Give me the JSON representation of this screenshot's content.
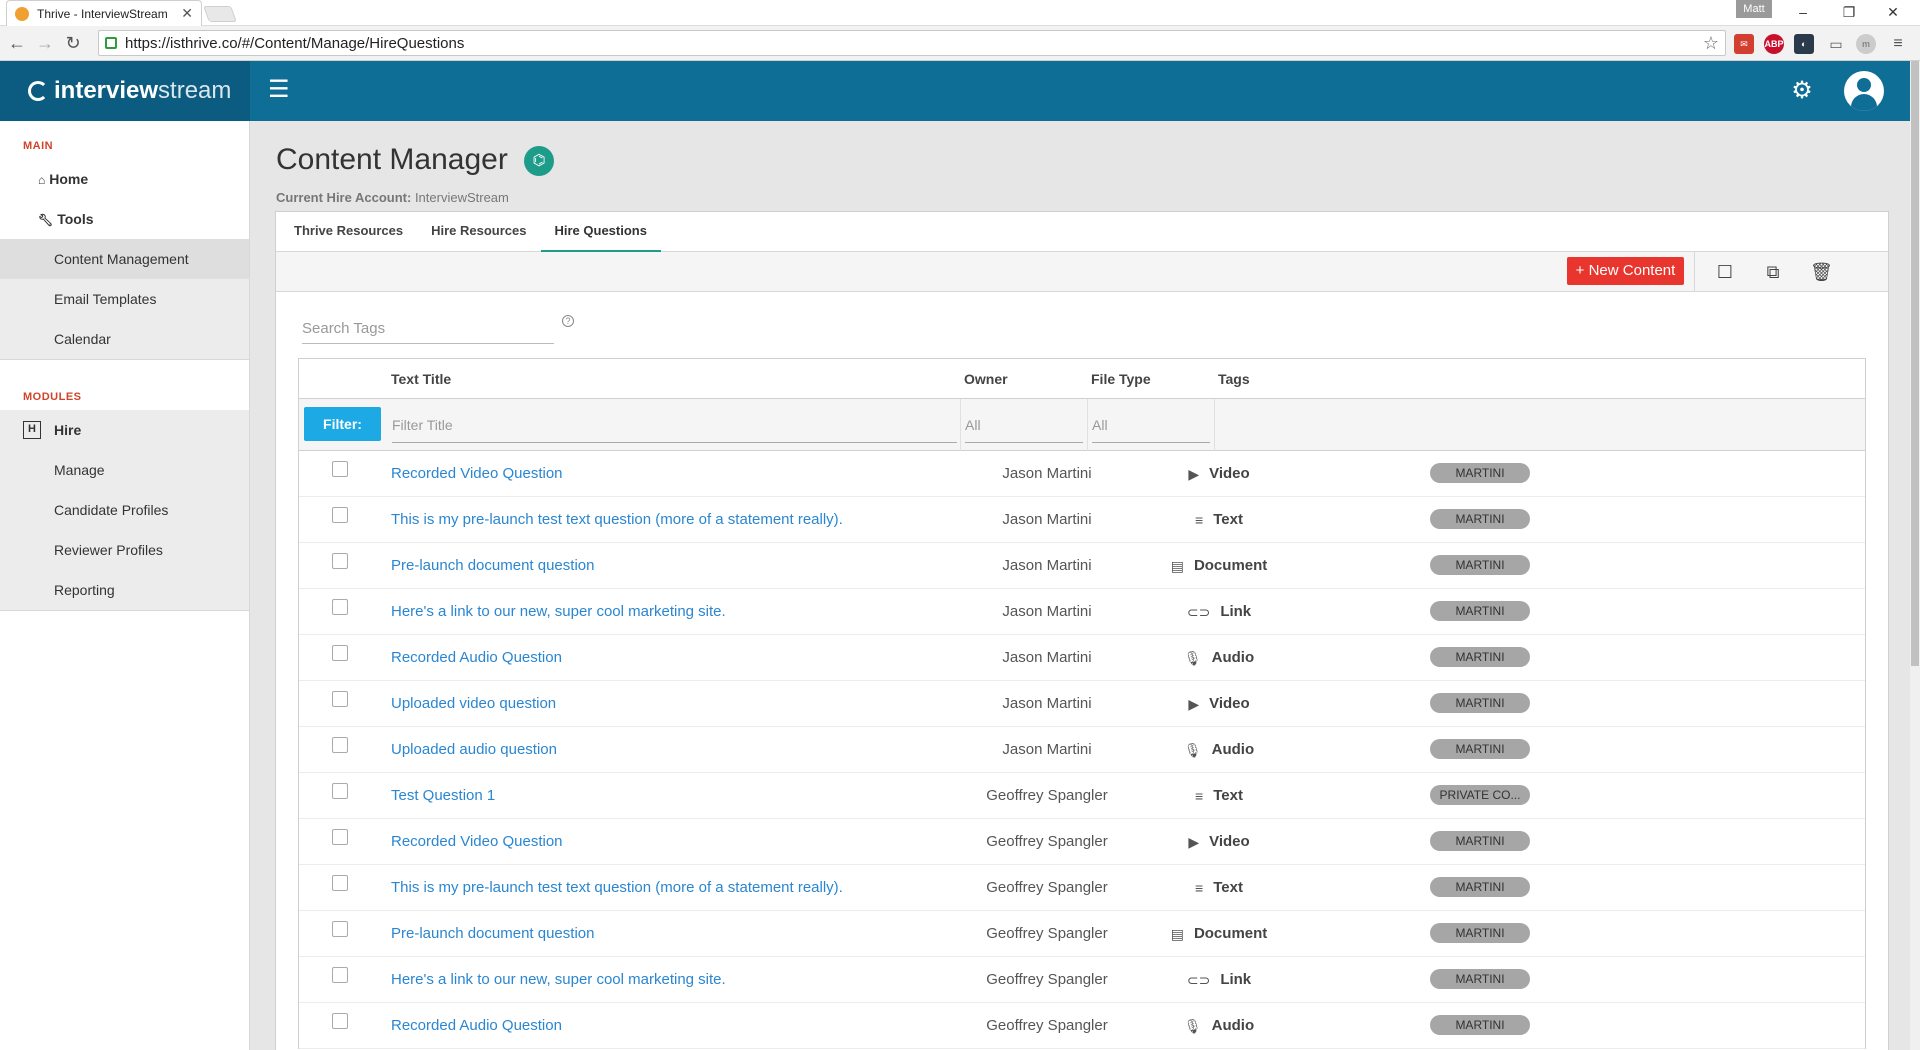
{
  "browser": {
    "tab_title": "Thrive - InterviewStream",
    "url": "https://isthrive.co/#/Content/Manage/HireQuestions",
    "profile": "Matt"
  },
  "header": {
    "logo_bold": "interview",
    "logo_light": "stream"
  },
  "sidebar": {
    "main_label": "MAIN",
    "main_items": [
      {
        "label": "Home",
        "icon": "home-icon"
      },
      {
        "label": "Tools",
        "icon": "wrench-icon"
      }
    ],
    "sub_items": [
      "Content Management",
      "Email Templates",
      "Calendar"
    ],
    "modules_label": "MODULES",
    "hire_label": "Hire",
    "hire_badge": "H",
    "hire_items": [
      "Manage",
      "Candidate Profiles",
      "Reviewer Profiles",
      "Reporting"
    ]
  },
  "main": {
    "title": "Content Manager",
    "account_label": "Current Hire Account:",
    "account_value": "InterviewStream",
    "tabs": [
      "Thrive Resources",
      "Hire Resources",
      "Hire Questions"
    ],
    "active_tab": "Hire Questions",
    "new_content": "+ New Content",
    "search_placeholder": "Search Tags",
    "table": {
      "headers": [
        "Text Title",
        "Owner",
        "File Type",
        "Tags"
      ],
      "filter_label": "Filter:",
      "filter_title_placeholder": "Filter Title",
      "filter_owner_placeholder": "All",
      "filter_type_placeholder": "All",
      "rows": [
        {
          "title": "Recorded Video Question",
          "owner": "Jason Martini",
          "type": "Video",
          "icon": "video-icon",
          "tag": "MARTINI"
        },
        {
          "title": "This is my pre-launch test text question (more of a statement really).",
          "owner": "Jason Martini",
          "type": "Text",
          "icon": "text-icon",
          "tag": "MARTINI"
        },
        {
          "title": "Pre-launch document question",
          "owner": "Jason Martini",
          "type": "Document",
          "icon": "document-icon",
          "tag": "MARTINI"
        },
        {
          "title": "Here's a link to our new, super cool marketing site.",
          "owner": "Jason Martini",
          "type": "Link",
          "icon": "link-icon",
          "tag": "MARTINI"
        },
        {
          "title": "Recorded Audio Question",
          "owner": "Jason Martini",
          "type": "Audio",
          "icon": "microphone-icon",
          "tag": "MARTINI"
        },
        {
          "title": "Uploaded video question",
          "owner": "Jason Martini",
          "type": "Video",
          "icon": "video-icon",
          "tag": "MARTINI"
        },
        {
          "title": "Uploaded audio question",
          "owner": "Jason Martini",
          "type": "Audio",
          "icon": "microphone-icon",
          "tag": "MARTINI"
        },
        {
          "title": "Test Question 1",
          "owner": "Geoffrey Spangler",
          "type": "Text",
          "icon": "text-icon",
          "tag": "PRIVATE CO..."
        },
        {
          "title": "Recorded Video Question",
          "owner": "Geoffrey Spangler",
          "type": "Video",
          "icon": "video-icon",
          "tag": "MARTINI"
        },
        {
          "title": "This is my pre-launch test text question (more of a statement really).",
          "owner": "Geoffrey Spangler",
          "type": "Text",
          "icon": "text-icon",
          "tag": "MARTINI"
        },
        {
          "title": "Pre-launch document question",
          "owner": "Geoffrey Spangler",
          "type": "Document",
          "icon": "document-icon",
          "tag": "MARTINI"
        },
        {
          "title": "Here's a link to our new, super cool marketing site.",
          "owner": "Geoffrey Spangler",
          "type": "Link",
          "icon": "link-icon",
          "tag": "MARTINI"
        },
        {
          "title": "Recorded Audio Question",
          "owner": "Geoffrey Spangler",
          "type": "Audio",
          "icon": "microphone-icon",
          "tag": "MARTINI"
        }
      ]
    }
  },
  "colors": {
    "header": "#0f6e96",
    "new_button": "#e8362e",
    "filter_button": "#1da9e4",
    "link": "#2a86d1",
    "section_label": "#d0442a"
  }
}
